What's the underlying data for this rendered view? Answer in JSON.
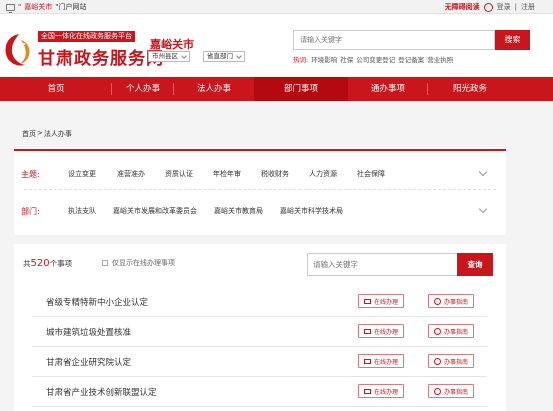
{
  "topbar": {
    "portal_prefix": "\"",
    "portal_city": "嘉峪关市",
    "portal_suffix": "\"门户网站",
    "accessibility": "无障碍阅读",
    "login": "登录",
    "divider": "|",
    "register": "注册"
  },
  "header": {
    "slogan": "全国一体化在线政务服务平台",
    "site_title": "甘肃政务服务网",
    "city": "嘉峪关市",
    "district_select": "市州县区",
    "dept_select": "省直部门",
    "search_placeholder": "请输入关键字",
    "search_button": "搜索",
    "hot_label": "热词:",
    "hot_words": [
      "环境影响",
      "社保",
      "公司变更登记",
      "登记备案",
      "营业执照"
    ]
  },
  "nav": [
    "首页",
    "个人办事",
    "法人办事",
    "部门事项",
    "通办事项",
    "阳光政务"
  ],
  "breadcrumb": {
    "home": "首页",
    "sep": ">",
    "current": "法人办事"
  },
  "filters": {
    "theme_label": "主题:",
    "themes": [
      "设立变更",
      "准营准办",
      "资质认证",
      "年检年审",
      "税收财务",
      "人力资源",
      "社会保障"
    ],
    "dept_label": "部门:",
    "depts": [
      "执法支队",
      "嘉峪关市发展和改革委员会",
      "嘉峪关市教育局",
      "嘉峪关市科学技术局"
    ]
  },
  "items": {
    "count_prefix": "共",
    "count": "520",
    "count_suffix": "个事项",
    "only_online": "仅显示在线办理事项",
    "keyword_placeholder": "请输入关键字",
    "query_button": "查询",
    "online_label": "在线办理",
    "guide_label": "办事指南",
    "rows": [
      "省级专精特新中小企业认定",
      "城市建筑垃圾处置核准",
      "甘肃省企业研究院认定",
      "甘肃省产业技术创新联盟认定"
    ]
  }
}
